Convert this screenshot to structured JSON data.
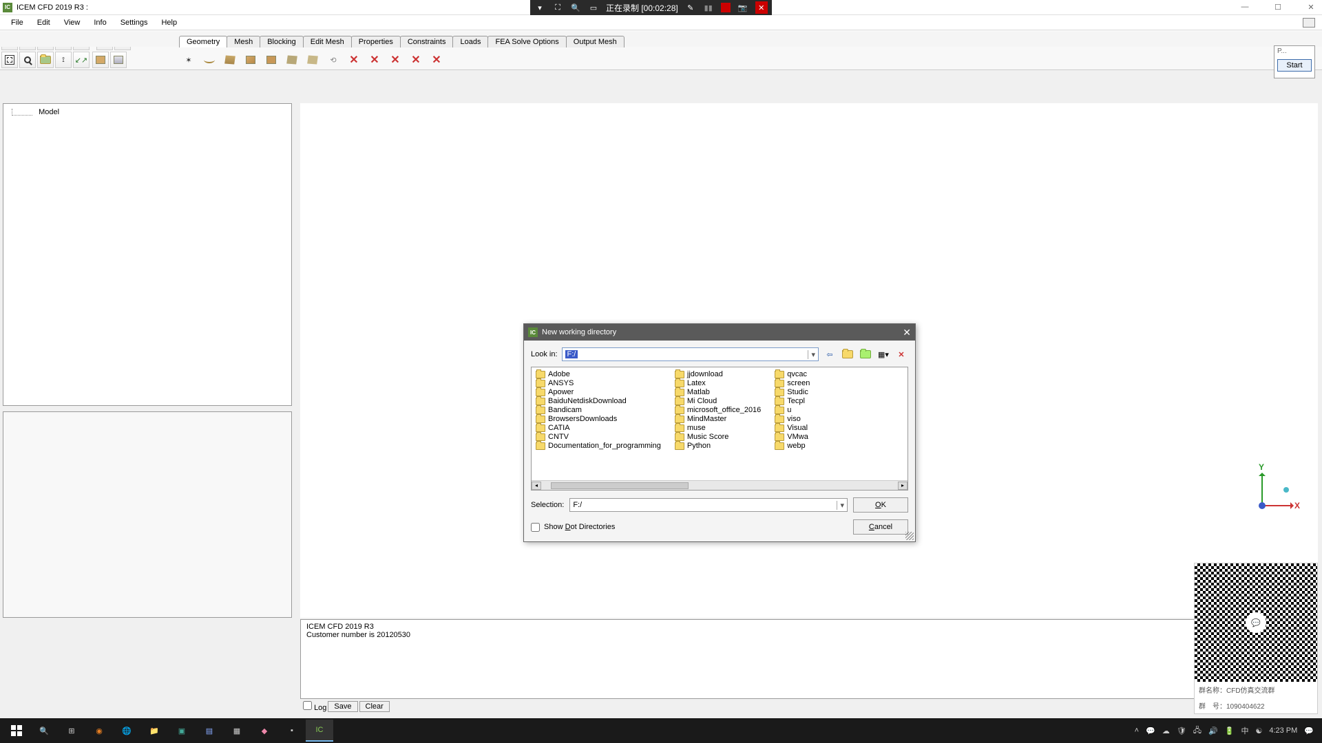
{
  "app": {
    "title": "ICEM CFD 2019 R3 :"
  },
  "recorder": {
    "status": "正在录制 [00:02:28]"
  },
  "menu": [
    "File",
    "Edit",
    "View",
    "Info",
    "Settings",
    "Help"
  ],
  "tabs": [
    "Geometry",
    "Mesh",
    "Blocking",
    "Edit Mesh",
    "Properties",
    "Constraints",
    "Loads",
    "FEA Solve Options",
    "Output Mesh"
  ],
  "active_tab": 0,
  "start_panel": {
    "p": "P...",
    "start": "Start"
  },
  "tree": {
    "root": "Model"
  },
  "axis": {
    "x": "X",
    "y": "Y",
    "z": ""
  },
  "log": {
    "line1": "ICEM CFD 2019 R3",
    "line2": "Customer number is 20120530",
    "log_label": "Log",
    "save": "Save",
    "clear": "Clear"
  },
  "qr": {
    "line1": "群名称：CFD仿真交流群",
    "line2": "群　号：1090404622"
  },
  "dialog": {
    "title": "New working directory",
    "lookin_label": "Look in:",
    "lookin_value": "F:/",
    "folders_col1": [
      "Adobe",
      "ANSYS",
      "Apower",
      "BaiduNetdiskDownload",
      "Bandicam",
      "BrowsersDownloads",
      "CATIA",
      "CNTV",
      "Documentation_for_programming"
    ],
    "folders_col2": [
      "jjdownload",
      "Latex",
      "Matlab",
      "Mi Cloud",
      "microsoft_office_2016",
      "MindMaster",
      "muse",
      "Music Score",
      "Python"
    ],
    "folders_col3": [
      "qvcac",
      "screen",
      "Studic",
      "Tecpl",
      "u",
      "viso",
      "Visual",
      "VMwa",
      "webp"
    ],
    "selection_label": "Selection:",
    "selection_value": "F:/",
    "ok": "OK",
    "cancel": "Cancel",
    "show_dot": "Show Dot Directories"
  },
  "taskbar": {
    "ime": "中",
    "time": "4:23 PM"
  }
}
